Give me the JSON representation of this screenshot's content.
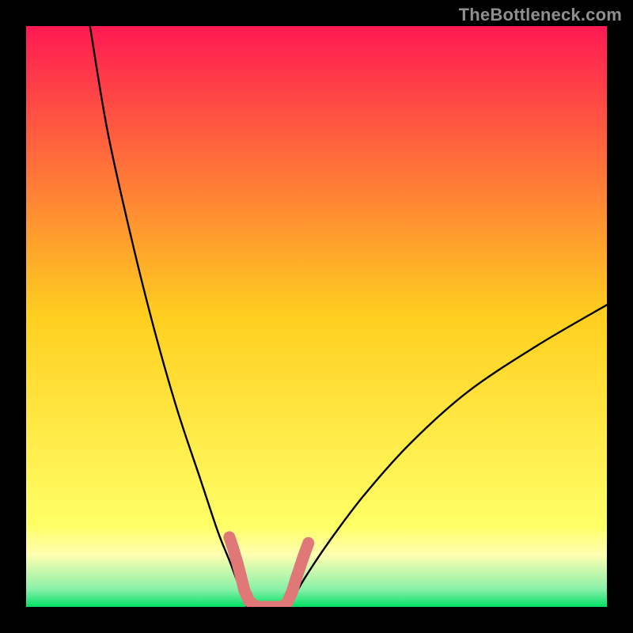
{
  "watermark": "TheBottleneck.com",
  "chart_data": {
    "type": "line",
    "title": "",
    "xlabel": "",
    "ylabel": "",
    "xlim": [
      0,
      100
    ],
    "ylim": [
      0,
      100
    ],
    "background_gradient": {
      "stops": [
        {
          "y": 100,
          "color": "#ff1a52"
        },
        {
          "y": 50,
          "color": "#ffcf1f"
        },
        {
          "y": 14,
          "color": "#ffff66"
        },
        {
          "y": 9,
          "color": "#ffffb0"
        },
        {
          "y": 3,
          "color": "#88f0a8"
        },
        {
          "y": 0,
          "color": "#00e164"
        }
      ]
    },
    "series": [
      {
        "name": "left-branch",
        "x": [
          11,
          14,
          18,
          22,
          26,
          30,
          33,
          35,
          36.5,
          37.5,
          38
        ],
        "y": [
          100,
          82,
          64,
          48,
          34,
          22,
          13,
          8,
          4,
          1.5,
          0
        ]
      },
      {
        "name": "right-branch",
        "x": [
          45,
          46,
          48,
          52,
          58,
          66,
          76,
          88,
          100
        ],
        "y": [
          0,
          1.5,
          5,
          11,
          19,
          28,
          37,
          45,
          52
        ]
      }
    ],
    "valley_floor": {
      "y": 0,
      "x_start": 38,
      "x_end": 45
    },
    "highlight_band": {
      "color": "#e07878",
      "segments": [
        {
          "x": 35.0,
          "y": 12.0
        },
        {
          "x": 35.6,
          "y": 10.2
        },
        {
          "x": 36.4,
          "y": 7.5
        },
        {
          "x": 37.0,
          "y": 5.2
        },
        {
          "x": 37.6,
          "y": 2.8
        },
        {
          "x": 38.4,
          "y": 1.0
        },
        {
          "x": 39.6,
          "y": 0.0
        },
        {
          "x": 41.2,
          "y": 0.0
        },
        {
          "x": 42.8,
          "y": 0.0
        },
        {
          "x": 44.2,
          "y": 0.0
        },
        {
          "x": 45.0,
          "y": 0.8
        },
        {
          "x": 45.8,
          "y": 2.6
        },
        {
          "x": 46.4,
          "y": 4.6
        },
        {
          "x": 47.2,
          "y": 7.0
        },
        {
          "x": 47.8,
          "y": 8.8
        },
        {
          "x": 48.6,
          "y": 11.0
        }
      ]
    }
  }
}
